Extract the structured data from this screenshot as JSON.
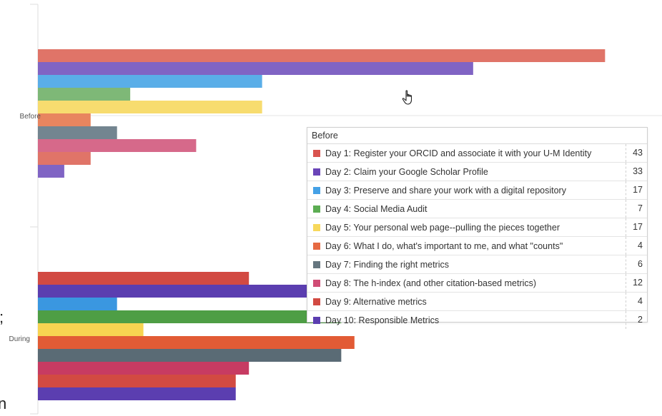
{
  "chart_data": {
    "type": "bar",
    "orientation": "horizontal",
    "categories": [
      "Before",
      "During"
    ],
    "series": [
      {
        "name": "Day 1: Register your ORCID and associate it with your U-M Identity",
        "color": "#e07468",
        "values": [
          43,
          16
        ]
      },
      {
        "name": "Day 2: Claim your Google Scholar Profile",
        "color": "#8064c4",
        "values": [
          33,
          21
        ]
      },
      {
        "name": "Day 3: Preserve and share your work with a digital repository",
        "color": "#5aaee8",
        "values": [
          17,
          6
        ]
      },
      {
        "name": "Day 4: Social Media Audit",
        "color": "#7eb877",
        "values": [
          7,
          23
        ]
      },
      {
        "name": "Day 5: Your personal web page--pulling the pieces together",
        "color": "#f7dc6f",
        "values": [
          17,
          8
        ]
      },
      {
        "name": "Day 6: What I do, what's important to me, and what \"counts\"",
        "color": "#e8855f",
        "values": [
          4,
          24
        ]
      },
      {
        "name": "Day 7: Finding the right metrics",
        "color": "#738590",
        "values": [
          6,
          23
        ]
      },
      {
        "name": "Day 8: The h-index (and other citation-based metrics)",
        "color": "#d6698a",
        "values": [
          12,
          16
        ]
      },
      {
        "name": "Day 9: Alternative metrics",
        "color": "#e07468",
        "values": [
          4,
          15
        ]
      },
      {
        "name": "Day 10: Responsible Metrics",
        "color": "#8064c4",
        "values": [
          2,
          15
        ]
      }
    ],
    "during_colors": [
      "#d24a42",
      "#5b3eb0",
      "#3a97e0",
      "#4e9e45",
      "#f7d451",
      "#e25b35",
      "#5a6b75",
      "#c73b62",
      "#d24a42",
      "#5b3eb0"
    ],
    "xlim": [
      0,
      47
    ]
  },
  "tooltip": {
    "title": "Before",
    "rows": [
      {
        "label": "Day 1: Register your ORCID and associate it with your U-M Identity",
        "value": "43",
        "color": "#d9534f"
      },
      {
        "label": "Day 2: Claim your Google Scholar Profile",
        "value": "33",
        "color": "#6a45b8"
      },
      {
        "label": "Day 3: Preserve and share your work with a digital repository",
        "value": "17",
        "color": "#45a1e6"
      },
      {
        "label": "Day 4: Social Media Audit",
        "value": "7",
        "color": "#5cad53"
      },
      {
        "label": "Day 5: Your personal web page--pulling the pieces together",
        "value": "17",
        "color": "#f7d85c"
      },
      {
        "label": "Day 6: What I do, what's important to me, and what \"counts\"",
        "value": "4",
        "color": "#e66a43"
      },
      {
        "label": "Day 7: Finding the right metrics",
        "value": "6",
        "color": "#66767f"
      },
      {
        "label": "Day 8: The h-index (and other citation-based metrics)",
        "value": "12",
        "color": "#d04c75"
      },
      {
        "label": "Day 9: Alternative metrics",
        "value": "4",
        "color": "#d24a42"
      },
      {
        "label": "Day 10: Responsible Metrics",
        "value": "2",
        "color": "#5b3eb0"
      }
    ]
  },
  "edge_glyphs": {
    "semicolon": ";",
    "letter_n": "n"
  },
  "cursor_icon": "hand-pointer-icon"
}
